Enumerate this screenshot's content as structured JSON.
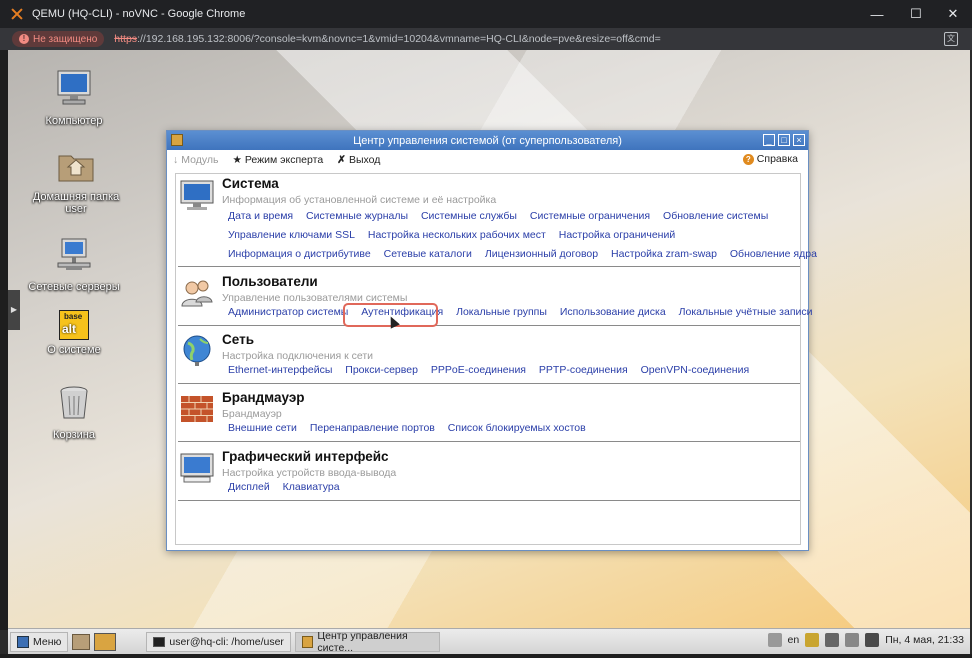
{
  "browser": {
    "title": "QEMU (HQ-CLI) - noVNC - Google Chrome",
    "security_badge": "Не защищено",
    "url_scheme": "https",
    "url_rest": "://192.168.195.132:8006/?console=kvm&novnc=1&vmid=10204&vmname=HQ-CLI&node=pve&resize=off&cmd=",
    "minimize": "—",
    "maximize": "☐",
    "close": "✕"
  },
  "desktop_icons": [
    {
      "label": "Компьютер",
      "icon": "computer-icon"
    },
    {
      "label": "Домашняя папка user",
      "icon": "home-folder-icon"
    },
    {
      "label": "Сетевые серверы",
      "icon": "network-servers-icon"
    },
    {
      "label": "О системе",
      "icon": "base-alt-icon",
      "logo_top": "base",
      "logo_bottom": "alt"
    },
    {
      "label": "Корзина",
      "icon": "trash-icon"
    }
  ],
  "window": {
    "title": "Центр управления системой (от суперпользователя)",
    "toolbar": {
      "module": "Модуль",
      "expert": "Режим эксперта",
      "exit": "Выход",
      "help": "Справка"
    },
    "sections": [
      {
        "title": "Система",
        "desc": "Информация об установленной системе и её настройка",
        "icon": "monitor-icon",
        "rows": [
          [
            "Дата и время",
            "Системные журналы",
            "Системные службы",
            "Системные ограничения",
            "Обновление системы"
          ],
          [
            "Управление ключами SSL",
            "Настройка нескольких рабочих мест",
            "Настройка ограничений"
          ],
          [
            "Информация о дистрибутиве",
            "Сетевые каталоги",
            "Лицензионный договор",
            "Настройка zram-swap",
            "Обновление ядра"
          ]
        ]
      },
      {
        "title": "Пользователи",
        "desc": "Управление пользователями системы",
        "icon": "users-icon",
        "rows": [
          [
            "Администратор системы",
            "Аутентификация",
            "Локальные группы",
            "Использование диска",
            "Локальные учётные записи"
          ]
        ]
      },
      {
        "title": "Сеть",
        "desc": "Настройка подключения к сети",
        "icon": "globe-icon",
        "rows": [
          [
            "Ethernet-интерфейсы",
            "Прокси-сервер",
            "PPPoE-соединения",
            "PPTP-соединения",
            "OpenVPN-соединения"
          ]
        ]
      },
      {
        "title": "Брандмауэр",
        "desc": "Брандмауэр",
        "icon": "firewall-icon",
        "rows": [
          [
            "Внешние сети",
            "Перенаправление портов",
            "Список блокируемых хостов"
          ]
        ]
      },
      {
        "title": "Графический интерфейс",
        "desc": "Настройка устройств ввода-вывода",
        "icon": "display-icon",
        "rows": [
          [
            "Дисплей",
            "Клавиатура"
          ]
        ]
      }
    ]
  },
  "taskbar": {
    "menu": "Меню",
    "tasks": [
      "user@hq-cli: /home/user",
      "Центр управления систе..."
    ],
    "lang": "en",
    "clock": "Пн, 4 мая, 21:33"
  }
}
